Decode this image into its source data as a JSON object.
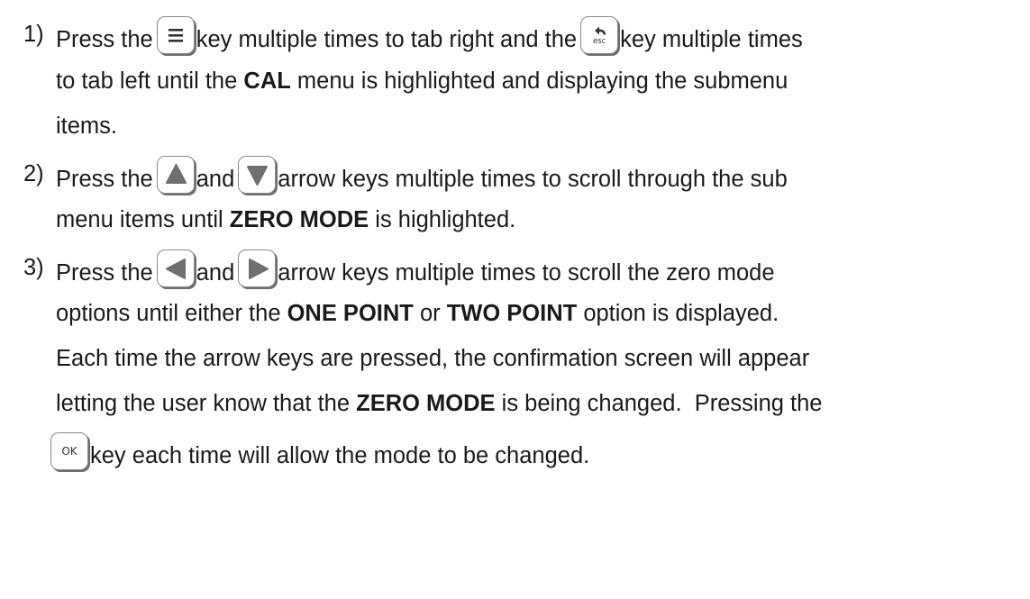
{
  "steps": [
    {
      "number": "1)",
      "lines": {
        "a": [
          "Press the",
          "key multiple times to tab right and the",
          "key multiple times"
        ],
        "b": [
          "to tab left until the",
          "CAL",
          "menu is highlighted and displaying the submenu"
        ],
        "c": [
          "items."
        ]
      }
    },
    {
      "number": "2)",
      "lines": {
        "a": [
          "Press the",
          "and",
          "arrow keys multiple times to scroll through the sub"
        ],
        "b": [
          "menu items until",
          "ZERO MODE",
          "is highlighted."
        ]
      }
    },
    {
      "number": "3)",
      "lines": {
        "a": [
          "Press the",
          "and",
          "arrow keys multiple times to scroll the zero mode"
        ],
        "b": [
          "options until either the",
          "ONE POINT",
          "or",
          "TWO POINT",
          "option is displayed."
        ],
        "c": [
          "Each time the arrow keys are pressed, the confirmation screen will appear"
        ],
        "d": [
          "letting the user know that the",
          "ZERO MODE",
          "is being changed.  Pressing the"
        ],
        "e": [
          "key each time will allow the mode to be changed."
        ]
      }
    }
  ],
  "keys": {
    "menu": {
      "icon": "menu-lines-icon"
    },
    "esc": {
      "icon": "back-arrow-icon",
      "label": "esc"
    },
    "up": {
      "icon": "triangle-up-icon"
    },
    "down": {
      "icon": "triangle-down-icon"
    },
    "left": {
      "icon": "triangle-left-icon"
    },
    "right": {
      "icon": "triangle-right-icon"
    },
    "ok": {
      "label": "OK"
    }
  },
  "colors": {
    "text": "#1a1a1a",
    "key_border": "#8a8a8a",
    "key_icon": "#6f6f6f"
  }
}
